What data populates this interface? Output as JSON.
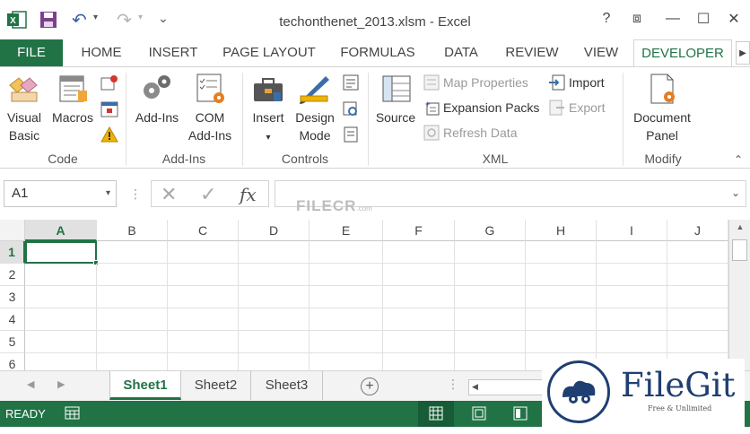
{
  "window": {
    "title": "techonthenet_2013.xlsm - Excel",
    "help": "?",
    "restore_ribbon": "⧈",
    "minimize": "—",
    "maximize": "☐",
    "close": "✕"
  },
  "qat": {
    "undo": "↶",
    "redo": "↷",
    "customize": "⌄"
  },
  "tabs": [
    {
      "label": "FILE"
    },
    {
      "label": "HOME"
    },
    {
      "label": "INSERT"
    },
    {
      "label": "PAGE LAYOUT"
    },
    {
      "label": "FORMULAS"
    },
    {
      "label": "DATA"
    },
    {
      "label": "REVIEW"
    },
    {
      "label": "VIEW"
    },
    {
      "label": "DEVELOPER"
    }
  ],
  "ribbon": {
    "code": {
      "label": "Code",
      "visual_basic": "Visual Basic",
      "visual_basic_l1": "Visual",
      "visual_basic_l2": "Basic",
      "macros": "Macros"
    },
    "addins": {
      "label": "Add-Ins",
      "addins": "Add-Ins",
      "com_l1": "COM",
      "com_l2": "Add-Ins"
    },
    "controls": {
      "label": "Controls",
      "insert": "Insert",
      "insert_dd": "▾",
      "design_l1": "Design",
      "design_l2": "Mode"
    },
    "xml": {
      "label": "XML",
      "source": "Source",
      "map_properties": "Map Properties",
      "expansion_packs": "Expansion Packs",
      "refresh_data": "Refresh Data",
      "import": "Import",
      "export": "Export"
    },
    "modify": {
      "label": "Modify",
      "doc_l1": "Document",
      "doc_l2": "Panel"
    },
    "collapse": "⌃"
  },
  "formula_bar": {
    "name_box": "A1",
    "name_dd": "▾",
    "cancel": "✕",
    "enter": "✓",
    "fx": "fx",
    "dots": "⋮",
    "formula_dd": "⌄"
  },
  "grid": {
    "columns": [
      "A",
      "B",
      "C",
      "D",
      "E",
      "F",
      "G",
      "H",
      "I",
      "J"
    ],
    "rows": [
      "1",
      "2",
      "3",
      "4",
      "5",
      "6"
    ],
    "active_column": "A",
    "active_row": "1"
  },
  "sheets": {
    "tabs": [
      "Sheet1",
      "Sheet2",
      "Sheet3"
    ],
    "active": "Sheet1",
    "add": "+",
    "prev": "◀",
    "next": "▶"
  },
  "status": {
    "ready": "READY"
  },
  "watermarks": {
    "filecr": "FILECR",
    "filecr_com": ".com",
    "filegit_name": "FileGit",
    "filegit_sub": "Free & Unlimited"
  },
  "colors": {
    "accent": "#217346",
    "accent_dark": "#185c37"
  }
}
